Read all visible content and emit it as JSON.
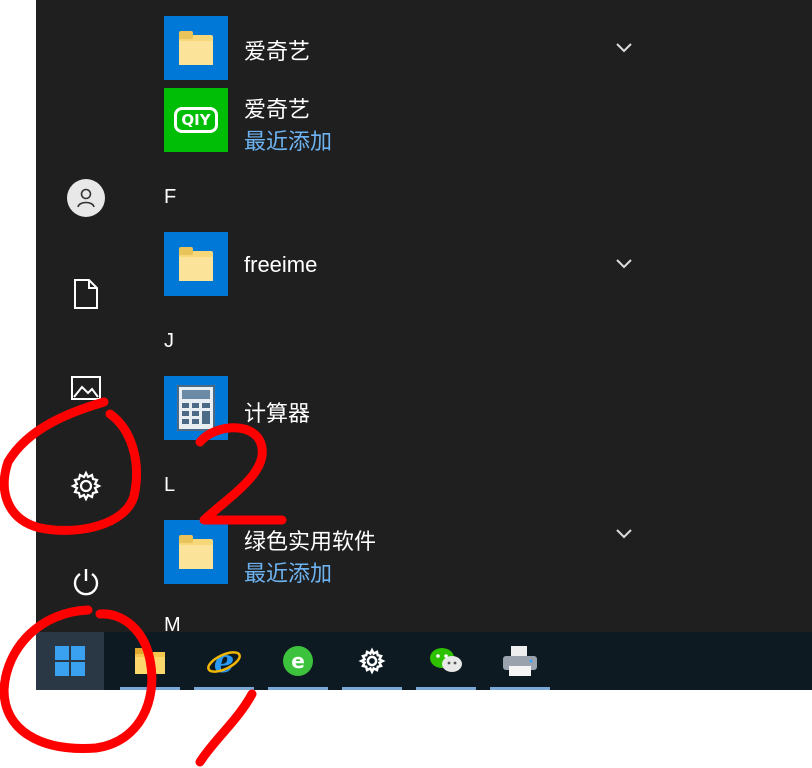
{
  "sidebar": {
    "items": [
      {
        "name": "user-account",
        "icon": "user-icon"
      },
      {
        "name": "documents",
        "icon": "document-icon"
      },
      {
        "name": "pictures",
        "icon": "pictures-icon"
      },
      {
        "name": "settings",
        "icon": "gear-icon"
      },
      {
        "name": "power",
        "icon": "power-icon"
      }
    ]
  },
  "apps": {
    "folder_iqiyi": {
      "label": "爱奇艺"
    },
    "iqiyi": {
      "label": "爱奇艺",
      "sub": "最近添加",
      "logo_text": "QIY"
    },
    "letter_f": "F",
    "freeime": {
      "label": "freeime"
    },
    "letter_j": "J",
    "calculator": {
      "label": "计算器"
    },
    "letter_l": "L",
    "green_software": {
      "label": "绿色实用软件",
      "sub": "最近添加"
    },
    "letter_m": "M"
  },
  "annotations": {
    "number": "2"
  },
  "colors": {
    "menu_bg": "#1f1f1f",
    "taskbar_bg": "#0e1a22",
    "accent": "#0078d7",
    "annotation": "#ff0000",
    "recent_link": "#6db3f2"
  },
  "taskbar": {
    "items": [
      {
        "name": "start",
        "icon": "windows-icon"
      },
      {
        "name": "file-explorer",
        "icon": "folder-icon"
      },
      {
        "name": "internet-explorer",
        "icon": "ie-icon"
      },
      {
        "name": "360-browser",
        "icon": "browser-e-icon"
      },
      {
        "name": "settings",
        "icon": "gear-icon"
      },
      {
        "name": "wechat",
        "icon": "wechat-icon"
      },
      {
        "name": "printer",
        "icon": "printer-icon"
      }
    ]
  }
}
